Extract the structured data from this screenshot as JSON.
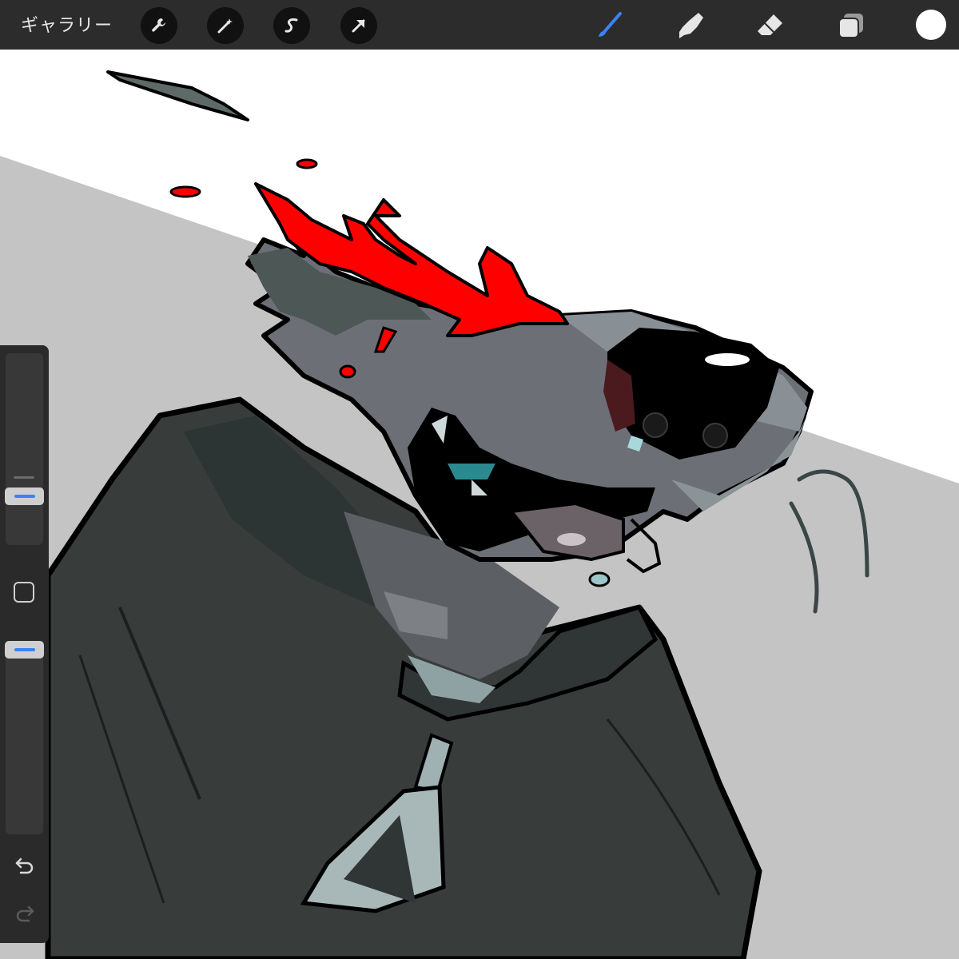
{
  "toolbar": {
    "gallery_label": "ギャラリー",
    "left_tools": [
      {
        "name": "actions",
        "icon": "wrench-icon"
      },
      {
        "name": "adjustments",
        "icon": "magic-wand-icon"
      },
      {
        "name": "selection",
        "icon": "selection-s-icon"
      },
      {
        "name": "transform",
        "icon": "arrow-cursor-icon"
      }
    ],
    "right_tools": [
      {
        "name": "brush",
        "icon": "brush-icon",
        "active": true
      },
      {
        "name": "smudge",
        "icon": "smudge-finger-icon"
      },
      {
        "name": "eraser",
        "icon": "eraser-icon"
      },
      {
        "name": "layers",
        "icon": "layers-icon"
      }
    ],
    "current_color": "#ffffff",
    "active_tool_color": "#3b82f6"
  },
  "sidebar": {
    "brush_size_icon": "size-slider",
    "brush_opacity_icon": "opacity-slider",
    "modify_button_icon": "square-modify-icon",
    "undo_icon": "undo-icon",
    "redo_icon": "redo-icon"
  },
  "canvas": {
    "description_colors": {
      "background_white": "#ffffff",
      "background_gray": "#c4c4c4",
      "fur_gray": "#6c7076",
      "hoodie": "#383d3c",
      "blood_red": "#ff0000",
      "nose": "#000000"
    }
  }
}
